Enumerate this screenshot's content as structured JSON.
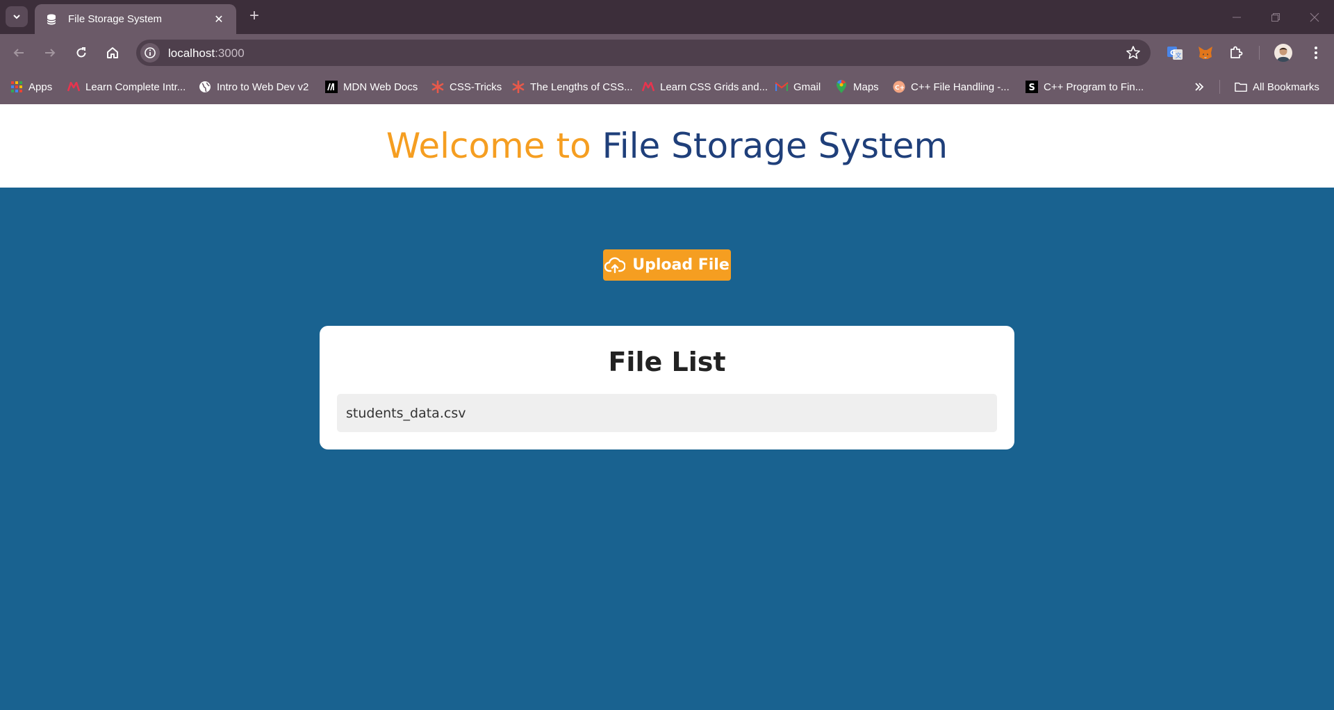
{
  "browser": {
    "tab_title": "File Storage System",
    "tab_close": "✕",
    "new_tab": "+",
    "url_host": "localhost",
    "url_port": ":3000",
    "all_bookmarks": "All Bookmarks",
    "bookmarks": [
      {
        "label": "Apps",
        "icon": "apps-grid-icon"
      },
      {
        "label": "Learn Complete Intr...",
        "icon": "m-logo-icon"
      },
      {
        "label": "Intro to Web Dev v2",
        "icon": "globe-icon"
      },
      {
        "label": "MDN Web Docs",
        "icon": "mdn-icon"
      },
      {
        "label": "CSS-Tricks",
        "icon": "asterisk-icon"
      },
      {
        "label": "The Lengths of CSS...",
        "icon": "asterisk-icon"
      },
      {
        "label": "Learn CSS Grids and...",
        "icon": "m-logo-icon"
      },
      {
        "label": "Gmail",
        "icon": "gmail-icon"
      },
      {
        "label": "Maps",
        "icon": "maps-pin-icon"
      },
      {
        "label": "C++ File Handling -...",
        "icon": "cpp-icon"
      },
      {
        "label": "C++ Program to Fin...",
        "icon": "s-logo-icon"
      }
    ]
  },
  "page": {
    "title_part1": "Welcome to",
    "title_part2": "File Storage System",
    "upload_label": "Upload File",
    "file_list_title": "File List",
    "files": [
      "students_data.csv"
    ]
  },
  "colors": {
    "accent_orange": "#f59e21",
    "title_navy": "#1f3f7a",
    "page_background": "#196290",
    "card_background": "#ffffff",
    "file_item_background": "#efefef"
  }
}
